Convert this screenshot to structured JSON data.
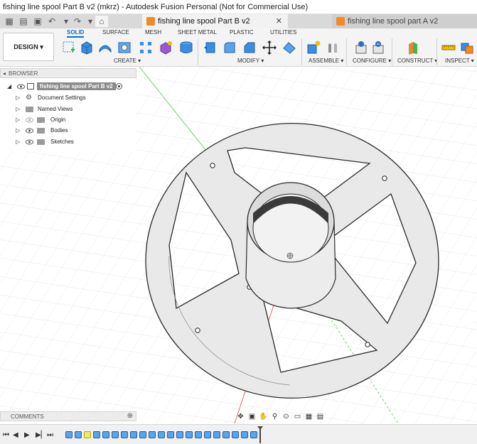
{
  "window": {
    "title": "fishing line spool Part B v2 (mkrz) - Autodesk Fusion Personal (Not for Commercial Use)"
  },
  "tabs": {
    "active": {
      "label": "fishing line spool Part B v2",
      "close_icon": "close-icon"
    },
    "inactive": {
      "label": "fishing line spool part A v2"
    }
  },
  "toolbar": {
    "design_label": "DESIGN",
    "workspace_tabs": [
      "SOLID",
      "SURFACE",
      "MESH",
      "SHEET METAL",
      "PLASTIC",
      "UTILITIES"
    ],
    "active_workspace_tab": "SOLID",
    "groups": {
      "create": "CREATE",
      "modify": "MODIFY",
      "assemble": "ASSEMBLE",
      "configure": "CONFIGURE",
      "construct": "CONSTRUCT",
      "inspect": "INSPECT"
    },
    "icons": {
      "create": [
        "new-sketch-icon",
        "extrude-icon",
        "revolve-icon",
        "hole-icon",
        "pattern-icon",
        "form-icon",
        "cylinder-icon"
      ],
      "modify": [
        "press-pull-icon",
        "fillet-icon",
        "chamfer-icon",
        "move-icon",
        "split-icon"
      ],
      "assemble": [
        "new-component-icon",
        "joint-icon"
      ],
      "configure": [
        "configure-table-icon",
        "configure-rule-icon"
      ],
      "construct": [
        "offset-plane-icon"
      ],
      "inspect": [
        "measure-icon",
        "interference-icon"
      ]
    }
  },
  "browser": {
    "header": "BROWSER",
    "root": {
      "label": "fishing line spool Part B v2"
    },
    "items": [
      {
        "label": "Document Settings",
        "icon": "gear-icon"
      },
      {
        "label": "Named Views",
        "icon": "folder-icon"
      },
      {
        "label": "Origin",
        "icon": "folder-icon"
      },
      {
        "label": "Bodies",
        "icon": "folder-icon"
      },
      {
        "label": "Sketches",
        "icon": "folder-icon"
      }
    ]
  },
  "comments": {
    "header": "COMMENTS"
  },
  "colors": {
    "accent": "#0a6fd1",
    "part_face": "#e9e9e9",
    "part_edge": "#2b2b2b",
    "axis_red": "#e06666",
    "axis_green": "#6fd06f",
    "grid": "#e4e4e4",
    "tab_icon": "#f08a24"
  },
  "nav_icons": [
    "orbit-icon",
    "look-at-icon",
    "pan-icon",
    "zoom-icon",
    "fit-icon",
    "display-settings-icon",
    "grid-settings-icon",
    "viewport-icon"
  ],
  "timeline": {
    "controls": [
      "go-to-start-icon",
      "step-back-icon",
      "play-icon",
      "step-forward-icon",
      "go-to-end-icon"
    ],
    "features": [
      "body",
      "body",
      "sketch",
      "body",
      "body",
      "body",
      "body",
      "body",
      "body",
      "body",
      "body",
      "body",
      "body",
      "body",
      "body",
      "body",
      "body",
      "body",
      "body",
      "body",
      "body"
    ]
  }
}
